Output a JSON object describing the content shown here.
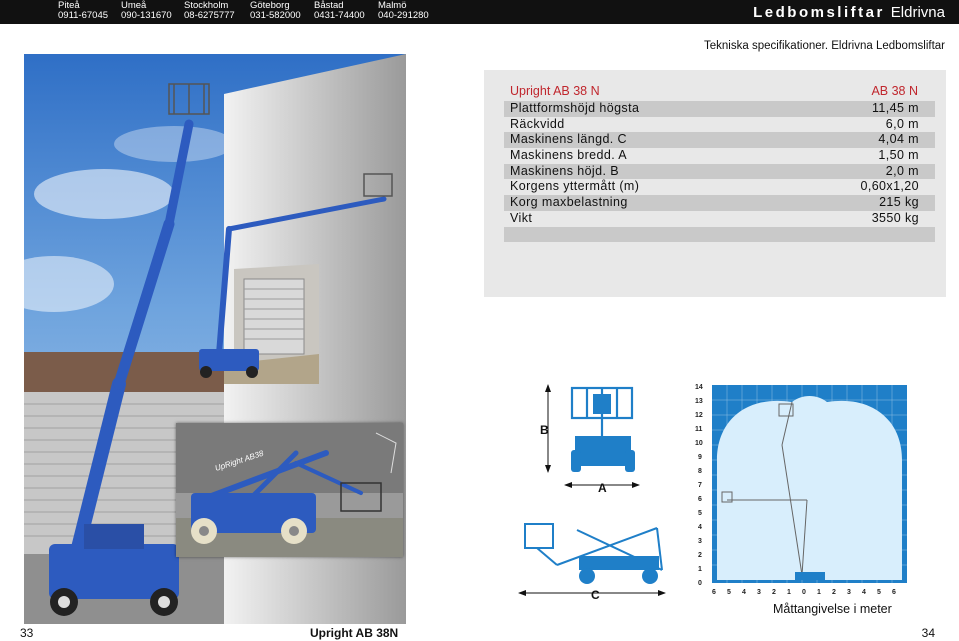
{
  "header": {
    "contacts": [
      {
        "city": "Piteå",
        "phone": "0911-67045"
      },
      {
        "city": "Umeå",
        "phone": "090-131670"
      },
      {
        "city": "Stockholm",
        "phone": "08-6275777"
      },
      {
        "city": "Göteborg",
        "phone": "031-582000"
      },
      {
        "city": "Båstad",
        "phone": "0431-74400"
      },
      {
        "city": "Malmö",
        "phone": "040-291280"
      }
    ],
    "brand_bold": "Ledbomsliftar",
    "brand_light": "Eldrivna"
  },
  "subtitle": "Tekniska specifikationer. Eldrivna Ledbomsliftar",
  "spec": {
    "model": "Upright AB 38 N",
    "column": "AB 38 N",
    "rows": [
      {
        "label": "Plattformshöjd högsta",
        "value": "11,45 m"
      },
      {
        "label": "Räckvidd",
        "value": "6,0 m"
      },
      {
        "label": "Maskinens längd. C",
        "value": "4,04 m"
      },
      {
        "label": "Maskinens bredd. A",
        "value": "1,50 m"
      },
      {
        "label": "Maskinens höjd.  B",
        "value": "2,0 m"
      },
      {
        "label": "Korgens yttermått (m)",
        "value": "0,60x1,20"
      },
      {
        "label": "Korg maxbelastning",
        "value": "215 kg"
      },
      {
        "label": "Vikt",
        "value": "3550 kg"
      },
      {
        "label": "",
        "value": ""
      }
    ]
  },
  "diagram": {
    "dim_b": "B",
    "dim_a": "A",
    "dim_c": "C",
    "y_ticks": [
      "14",
      "13",
      "12",
      "11",
      "10",
      "9",
      "8",
      "7",
      "6",
      "5",
      "4",
      "3",
      "2",
      "1",
      "0"
    ],
    "x_ticks": [
      "6",
      "5",
      "4",
      "3",
      "2",
      "1",
      "0",
      "1",
      "2",
      "3",
      "4",
      "5",
      "6"
    ],
    "machine_label": "UpRight AB38"
  },
  "caption_range": "Måttangivelse i meter",
  "footer": {
    "page_left": "33",
    "title": "Upright AB 38N",
    "page_right": "34"
  },
  "colors": {
    "machine_blue": "#2d5bbf",
    "diagram_blue": "#1f7fc8",
    "range_fill": "#d8eefc",
    "accent_red": "#c0262d"
  }
}
